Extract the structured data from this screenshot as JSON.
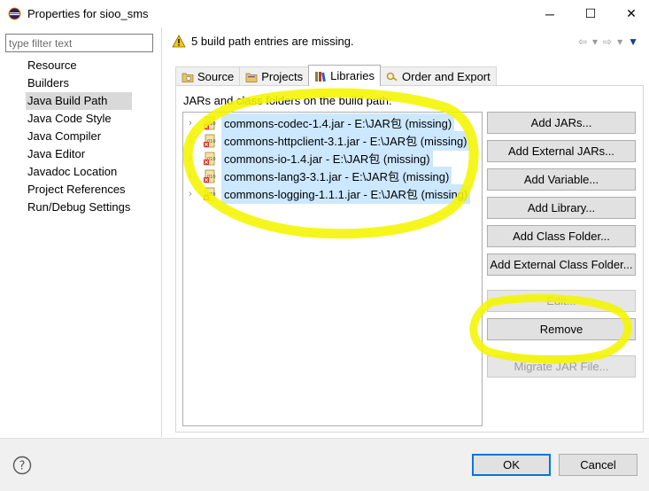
{
  "window": {
    "title": "Properties for sioo_sms",
    "minimize": "─",
    "maximize": "☐",
    "close": "✕"
  },
  "sidebar": {
    "filter_placeholder": "type filter text",
    "items": [
      {
        "label": "Resource"
      },
      {
        "label": "Builders"
      },
      {
        "label": "Java Build Path",
        "selected": true
      },
      {
        "label": "Java Code Style"
      },
      {
        "label": "Java Compiler"
      },
      {
        "label": "Java Editor"
      },
      {
        "label": "Javadoc Location"
      },
      {
        "label": "Project References"
      },
      {
        "label": "Run/Debug Settings"
      }
    ]
  },
  "header": {
    "warning_text": "5 build path entries are missing.",
    "warning_icon": "warning-triangle-icon"
  },
  "tabs": [
    {
      "label": "Source",
      "icon": "source-folder-icon"
    },
    {
      "label": "Projects",
      "icon": "projects-icon"
    },
    {
      "label": "Libraries",
      "icon": "libraries-icon",
      "active": true
    },
    {
      "label": "Order and Export",
      "icon": "order-export-icon"
    }
  ],
  "libraries": {
    "label": "JARs and class folders on the build path:",
    "entries": [
      {
        "label": "commons-codec-1.4.jar - E:\\JAR包 (missing)"
      },
      {
        "label": "commons-httpclient-3.1.jar - E:\\JAR包 (missing)"
      },
      {
        "label": "commons-io-1.4.jar - E:\\JAR包 (missing)"
      },
      {
        "label": "commons-lang3-3.1.jar - E:\\JAR包 (missing)"
      },
      {
        "label": "commons-logging-1.1.1.jar - E:\\JAR包 (missing)"
      }
    ],
    "buttons": {
      "add_jars": "Add JARs...",
      "add_external_jars": "Add External JARs...",
      "add_variable": "Add Variable...",
      "add_library": "Add Library...",
      "add_class_folder": "Add Class Folder...",
      "add_external_class_folder": "Add External Class Folder...",
      "edit": "Edit...",
      "remove": "Remove",
      "migrate_jar": "Migrate JAR File..."
    }
  },
  "footer": {
    "ok": "OK",
    "cancel": "Cancel"
  },
  "colors": {
    "selection": "#cce8ff",
    "highlight_marker": "#f5f500",
    "default_button_border": "#0078d7"
  }
}
